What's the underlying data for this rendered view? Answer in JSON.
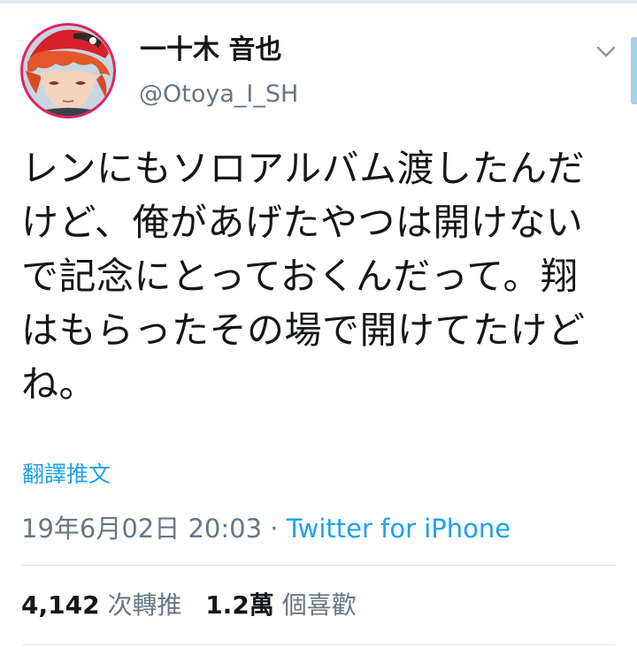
{
  "user": {
    "display_name": "一十木 音也",
    "handle": "@Otoya_I_SH"
  },
  "tweet": {
    "lines": [
      "レンにもソロアルバム渡したんだ",
      "けど、俺があげたやつは開けない",
      "で記念にとっておくんだって。翔",
      "はもらったその場で開けてたけど",
      "ね。"
    ],
    "translate_label": "翻譯推文",
    "timestamp": "19年6月02日 20:03",
    "separator": " · ",
    "source": "Twitter for iPhone"
  },
  "stats": {
    "retweets_count": "4,142",
    "retweets_label": "次轉推",
    "likes_count": "1.2萬",
    "likes_label": "個喜歡"
  },
  "icons": {
    "menu": "chevron-down-icon"
  },
  "colors": {
    "link": "#1da1f2",
    "secondary_text": "#657786",
    "primary_text": "#14171a",
    "avatar_border": "#e0245e"
  }
}
